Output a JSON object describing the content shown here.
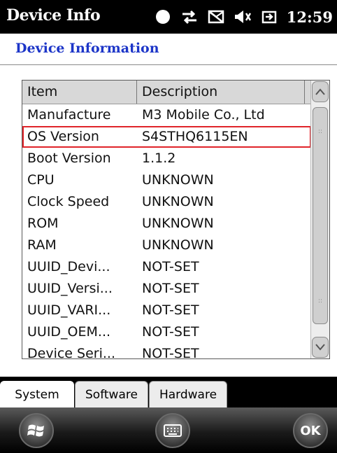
{
  "status_bar": {
    "app_title": "Device Info",
    "clock": "12:59",
    "icons": [
      "battery-status-icon",
      "data-sync-icon",
      "no-message-icon",
      "speaker-muted-icon",
      "power-plug-icon"
    ]
  },
  "header": {
    "title": "Device Information"
  },
  "table": {
    "columns": [
      "Item",
      "Description"
    ],
    "rows": [
      {
        "item": "Manufacture",
        "description": "M3 Mobile Co., Ltd"
      },
      {
        "item": "OS Version",
        "description": "S4STHQ6115EN"
      },
      {
        "item": "Boot Version",
        "description": "1.1.2"
      },
      {
        "item": "CPU",
        "description": "UNKNOWN"
      },
      {
        "item": "Clock Speed",
        "description": "UNKNOWN"
      },
      {
        "item": "ROM",
        "description": "UNKNOWN"
      },
      {
        "item": "RAM",
        "description": "UNKNOWN"
      },
      {
        "item": "UUID_Devi...",
        "description": "NOT-SET"
      },
      {
        "item": "UUID_Versi...",
        "description": "NOT-SET"
      },
      {
        "item": "UUID_VARI...",
        "description": "NOT-SET"
      },
      {
        "item": "UUID_OEM...",
        "description": "NOT-SET"
      },
      {
        "item": "Device Seri...",
        "description": "NOT-SET"
      }
    ],
    "highlighted_row": "OS Version",
    "highlight_color": "#e0242a"
  },
  "tabs": [
    {
      "label": "System",
      "active": true
    },
    {
      "label": "Software",
      "active": false
    },
    {
      "label": "Hardware",
      "active": false
    }
  ],
  "softkeys": {
    "start_icon": "windows-start-icon",
    "keyboard_icon": "keyboard-icon",
    "ok_label": "OK"
  },
  "colors": {
    "header_title": "#1c35c8",
    "status_bar_bg": "#000000"
  }
}
